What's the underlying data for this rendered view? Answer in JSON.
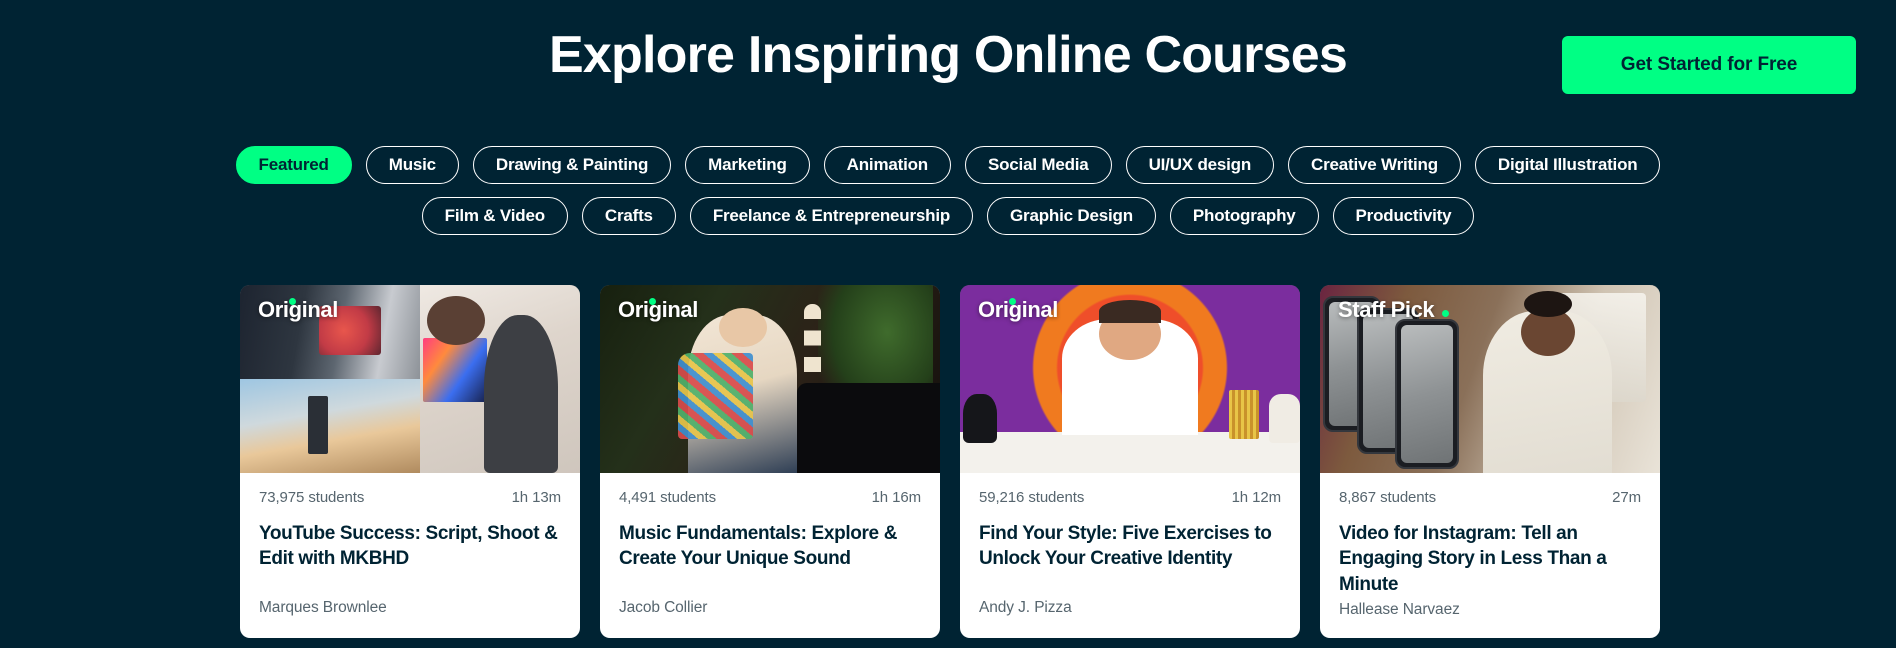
{
  "header": {
    "title": "Explore Inspiring Online Courses",
    "cta_label": "Get Started for Free",
    "cta_color": "#00ff84"
  },
  "theme": {
    "background": "#002333",
    "accent": "#00ff84",
    "card_background": "#ffffff",
    "title_text": "#002333",
    "meta_text": "#56656e"
  },
  "filters": {
    "items": [
      {
        "label": "Featured",
        "active": true
      },
      {
        "label": "Music",
        "active": false
      },
      {
        "label": "Drawing & Painting",
        "active": false
      },
      {
        "label": "Marketing",
        "active": false
      },
      {
        "label": "Animation",
        "active": false
      },
      {
        "label": "Social Media",
        "active": false
      },
      {
        "label": "UI/UX design",
        "active": false
      },
      {
        "label": "Creative Writing",
        "active": false
      },
      {
        "label": "Digital Illustration",
        "active": false
      },
      {
        "label": "Film & Video",
        "active": false
      },
      {
        "label": "Crafts",
        "active": false
      },
      {
        "label": "Freelance & Entrepreneurship",
        "active": false
      },
      {
        "label": "Graphic Design",
        "active": false
      },
      {
        "label": "Photography",
        "active": false
      },
      {
        "label": "Productivity",
        "active": false
      }
    ]
  },
  "courses": [
    {
      "badge": "Original",
      "badge_type": "original",
      "students": "73,975 students",
      "duration": "1h 13m",
      "title": "YouTube Success: Script, Shoot & Edit with MKBHD",
      "author": "Marques Brownlee"
    },
    {
      "badge": "Original",
      "badge_type": "original",
      "students": "4,491 students",
      "duration": "1h 16m",
      "title": "Music Fundamentals: Explore & Create Your Unique Sound",
      "author": "Jacob Collier"
    },
    {
      "badge": "Original",
      "badge_type": "original",
      "students": "59,216 students",
      "duration": "1h 12m",
      "title": "Find Your Style: Five Exercises to Unlock Your Creative Identity",
      "author": "Andy J. Pizza"
    },
    {
      "badge": "Staff Pick",
      "badge_type": "staffpick",
      "students": "8,867 students",
      "duration": "27m",
      "title": "Video for Instagram: Tell an Engaging Story in Less Than a Minute",
      "author": "Hallease Narvaez"
    }
  ]
}
